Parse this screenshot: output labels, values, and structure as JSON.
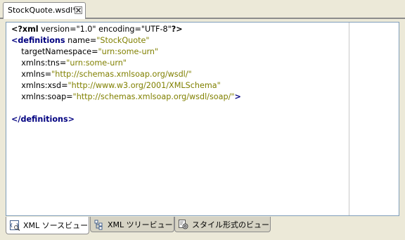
{
  "editor_tab": {
    "title": "StockQuote.wsdl*",
    "close_icon": "close-icon"
  },
  "code_lines": [
    {
      "type": "pi",
      "open": "<?",
      "name": "xml",
      "rest_attr1": " version=",
      "v1": "\"1.0\"",
      "rest_attr2": " encoding=",
      "v2": "\"UTF-8\"",
      "close": "?>"
    },
    {
      "type": "open",
      "indent": "",
      "tag": "<definitions",
      "attr": " name=",
      "val": "\"StockQuote\"",
      "end": ""
    },
    {
      "type": "attr",
      "indent": "    ",
      "attr": "targetNamespace=",
      "val": "\"urn:some-urn\"",
      "end": ""
    },
    {
      "type": "attr",
      "indent": "    ",
      "attr": "xmlns:tns=",
      "val": "\"urn:some-urn\"",
      "end": ""
    },
    {
      "type": "attr",
      "indent": "    ",
      "attr": "xmlns=",
      "val": "\"http://schemas.xmlsoap.org/wsdl/\"",
      "end": ""
    },
    {
      "type": "attr",
      "indent": "    ",
      "attr": "xmlns:xsd=",
      "val": "\"http://www.w3.org/2001/XMLSchema\"",
      "end": ""
    },
    {
      "type": "attr",
      "indent": "    ",
      "attr": "xmlns:soap=",
      "val": "\"http://schemas.xmlsoap.org/wsdl/soap/\"",
      "end": ">"
    },
    {
      "type": "blank"
    },
    {
      "type": "close",
      "indent": "",
      "tag": "</definitions>"
    }
  ],
  "bottom_tabs": [
    {
      "label": "XML ソースビュー",
      "icon": "xml-source-icon",
      "active": true
    },
    {
      "label": "XML ツリービュー",
      "icon": "xml-tree-icon",
      "active": false
    },
    {
      "label": "スタイル形式のビュー",
      "icon": "style-view-icon",
      "active": false
    }
  ]
}
